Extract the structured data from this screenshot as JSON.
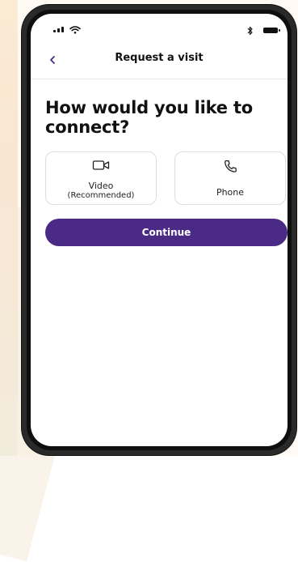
{
  "header": {
    "title": "Request a visit"
  },
  "main": {
    "heading_line1": "How would you like to",
    "heading_line2": "connect?"
  },
  "options": [
    {
      "label": "Video",
      "sub_label": "(Recommended)",
      "icon": "video-icon"
    },
    {
      "label": "Phone",
      "icon": "phone-icon"
    }
  ],
  "actions": {
    "continue_label": "Continue"
  },
  "colors": {
    "primary": "#4b2a86",
    "text": "#111111",
    "border": "#dcdce4"
  },
  "status_bar": {
    "signal_icon": "signal-icon",
    "wifi_icon": "wifi-icon",
    "bluetooth_icon": "bluetooth-icon",
    "battery_icon": "battery-icon"
  }
}
